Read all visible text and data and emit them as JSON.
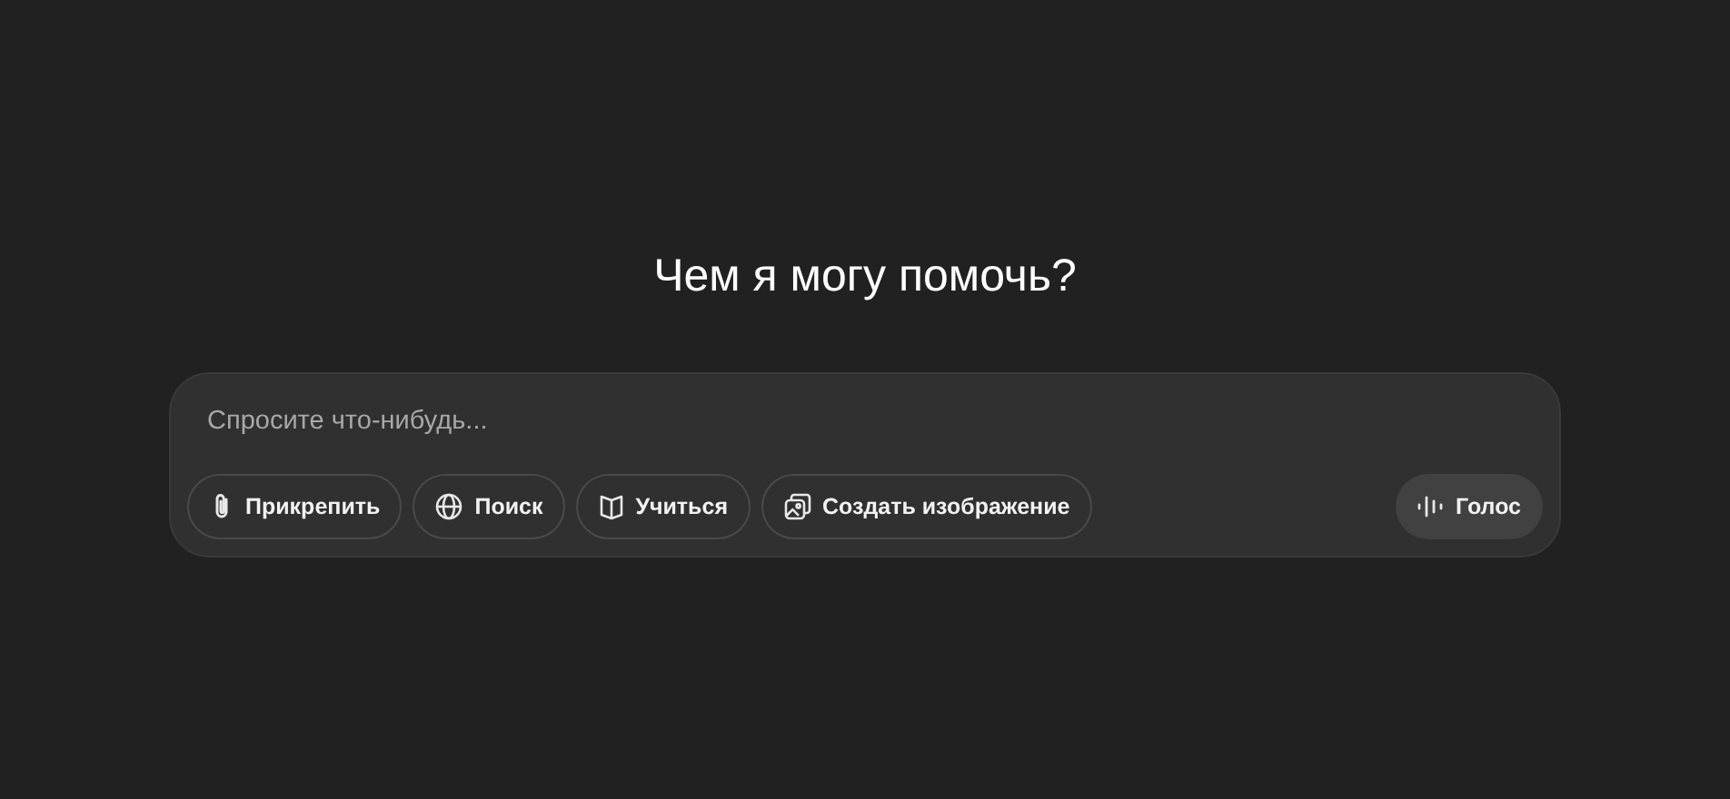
{
  "heading": "Чем я могу помочь?",
  "composer": {
    "placeholder": "Спросите что-нибудь...",
    "tools": [
      {
        "label": "Прикрепить"
      },
      {
        "label": "Поиск"
      },
      {
        "label": "Учиться"
      },
      {
        "label": "Создать изображение"
      }
    ],
    "voice_button": {
      "label": "Голос"
    }
  }
}
